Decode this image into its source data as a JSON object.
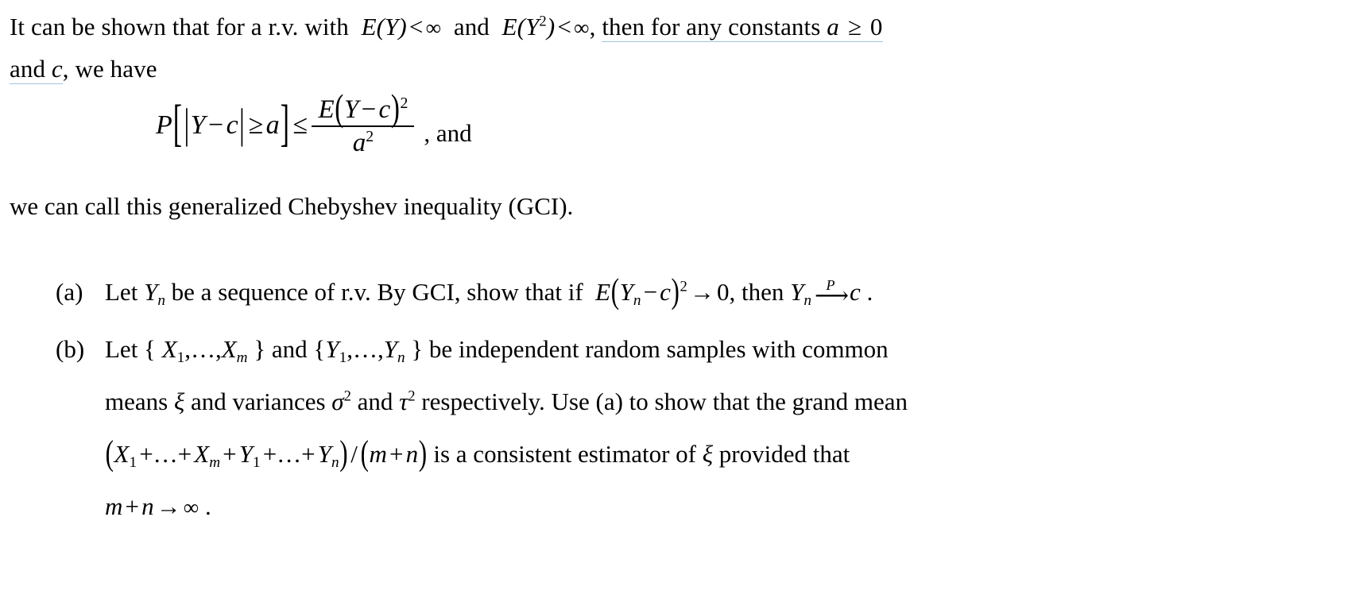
{
  "document": {
    "type": "math-problem-page",
    "background_color": "#ffffff",
    "text_color": "#000000",
    "proofing_underline_color": "#9ec6dd",
    "intro": {
      "line1": {
        "plain_a": "It can be shown that for a r.v. with",
        "math_EY": "E(Y)",
        "lt1": "<",
        "infinity": "∞",
        "and1": "and",
        "math_EY2_base": "E(Y",
        "math_EY2_exp": "2",
        "math_EY2_close": ")",
        "lt2": "<",
        "comma": ",",
        "underlined_tail": "then for any constants",
        "const_a": "a",
        "geq": "≥",
        "zero": "0"
      },
      "line2": {
        "and": "and",
        "const_c": "c",
        "rest": ", we have"
      }
    },
    "equation": {
      "P": "P",
      "bracket_open": "[",
      "abs_open": "|",
      "Y": "Y",
      "minus": "−",
      "c": "c",
      "abs_close": "|",
      "geq": "≥",
      "a": "a",
      "bracket_close": "]",
      "leq": "≤",
      "numerator": {
        "E": "E",
        "paren_open": "(",
        "Y": "Y",
        "minus": "−",
        "c": "c",
        "paren_close": ")",
        "exponent": "2"
      },
      "denominator": {
        "a": "a",
        "exponent": "2"
      },
      "tail": ", and",
      "latex": "P\\left[\\,|Y-c|\\ge a\\,\\right]\\le \\frac{E\\left(Y-c\\right)^{2}}{a^{2}}"
    },
    "gci_line": "we can call this generalized Chebyshev inequality (GCI).",
    "problems": [
      {
        "marker": "(a)",
        "segments": {
          "s1": "Let",
          "Y": "Y",
          "Y_sub": "n",
          "s2": "be a sequence of r.v. By GCI, show that if",
          "E": "E",
          "paren_open": "(",
          "Y2": "Y",
          "Y2_sub": "n",
          "minus": "−",
          "c": "c",
          "paren_close": ")",
          "exp": "2",
          "to": "→",
          "zero": "0",
          "s3": ", then",
          "Y3": "Y",
          "Y3_sub": "n",
          "arrow_label": "P",
          "arrow": "⟶",
          "limit_c": "c",
          "period": "."
        },
        "latex": "\\text{Let } Y_n \\text{ be a sequence of r.v. By GCI, show that if } E\\left(Y_n-c\\right)^2\\to 0,\\text{ then } Y_n \\xrightarrow{P} c."
      },
      {
        "marker": "(b)",
        "row1": {
          "s1": "Let {",
          "X1": "X",
          "X1_sub": "1",
          "dots1": ",…,",
          "Xm": "X",
          "Xm_sub": "m",
          "s2": "} and {",
          "Y1": "Y",
          "Y1_sub": "1",
          "dots2": ",…,",
          "Yn": "Y",
          "Yn_sub": "n",
          "s3": "}  be  independent random samples with common"
        },
        "row2": {
          "s1": "means",
          "xi": "ξ",
          "s2": "and variances",
          "sigma": "σ",
          "sigma_exp": "2",
          "s3": "and",
          "tau": "τ",
          "tau_exp": "2",
          "s4": "respectively. Use (a) to show that the grand mean"
        },
        "row3": {
          "paren_open": "(",
          "X1": "X",
          "X1_sub": "1",
          "plus1": "+…+",
          "Xm": "X",
          "Xm_sub": "m",
          "plus2": "+",
          "Y1": "Y",
          "Y1_sub": "1",
          "plus3": "+…+",
          "Yn": "Y",
          "Yn_sub": "n",
          "paren_close": ")",
          "slash": "/",
          "paren2_open": "(",
          "m": "m",
          "plus4": "+",
          "n": "n",
          "paren2_close": ")",
          "s1": "is  a  consistent  estimator  of",
          "xi": "ξ",
          "s2": "provided  that"
        },
        "row4": {
          "m": "m",
          "plus": "+",
          "n": "n",
          "to": "→",
          "infinity": "∞",
          "period": "."
        },
        "latex": "\\text{Let }\\{X_1,\\dots,X_m\\}\\text{ and }\\{Y_1,\\dots,Y_n\\}\\text{ be independent random samples with common means }\\xi\\text{ and variances }\\sigma^2\\text{ and }\\tau^2\\text{ respectively. Use (a) to show that the grand mean }\\left(X_1+\\dots+X_m+Y_1+\\dots+Y_n\\right)/\\left(m+n\\right)\\text{ is a consistent estimator of }\\xi\\text{ provided that } m+n\\to\\infty."
      }
    ]
  }
}
